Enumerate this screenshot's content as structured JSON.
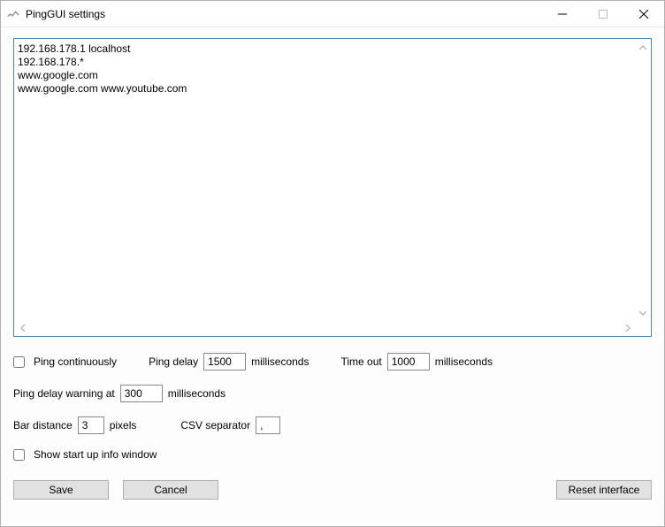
{
  "window": {
    "title": "PingGUI settings"
  },
  "hosts_text": "192.168.178.1 localhost\n192.168.178.*\nwww.google.com\nwww.google.com www.youtube.com",
  "ping_continuously": {
    "label": "Ping continuously",
    "checked": false
  },
  "ping_delay": {
    "label": "Ping delay",
    "value": "1500",
    "unit": "milliseconds"
  },
  "time_out": {
    "label": "Time out",
    "value": "1000",
    "unit": "milliseconds"
  },
  "warning": {
    "label_pre": "Ping delay warning at",
    "value": "300",
    "unit": "milliseconds"
  },
  "bar_distance": {
    "label": "Bar distance",
    "value": "3",
    "unit": "pixels"
  },
  "csv_separator": {
    "label": "CSV separator",
    "value": ","
  },
  "show_startup": {
    "label": "Show start up info window",
    "checked": false
  },
  "buttons": {
    "save": "Save",
    "cancel": "Cancel",
    "reset": "Reset interface"
  }
}
